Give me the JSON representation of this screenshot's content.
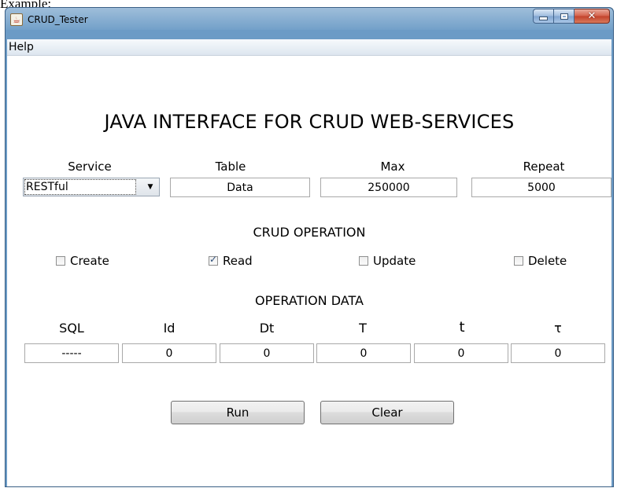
{
  "top_text": "Example:",
  "window": {
    "title": "CRUD_Tester"
  },
  "menu": {
    "help": "Help"
  },
  "heading": "JAVA INTERFACE FOR CRUD WEB-SERVICES",
  "config": {
    "service_label": "Service",
    "table_label": "Table",
    "max_label": "Max",
    "repeat_label": "Repeat",
    "service_value": "RESTful",
    "table_value": "Data",
    "max_value": "250000",
    "repeat_value": "5000"
  },
  "crud": {
    "title": "CRUD OPERATION",
    "create": "Create",
    "read": "Read",
    "update": "Update",
    "delete": "Delete",
    "checked": {
      "create": false,
      "read": true,
      "update": false,
      "delete": false
    }
  },
  "opdata": {
    "title": "OPERATION DATA",
    "headers": [
      "SQL",
      "Id",
      "Dt",
      "T",
      "t",
      "τ"
    ],
    "values": [
      "-----",
      "0",
      "0",
      "0",
      "0",
      "0"
    ]
  },
  "buttons": {
    "run": "Run",
    "clear": "Clear"
  },
  "colors": {
    "titlebar": "#6b9bc6",
    "close": "#c2412a",
    "menubar": "#e6edf4"
  }
}
